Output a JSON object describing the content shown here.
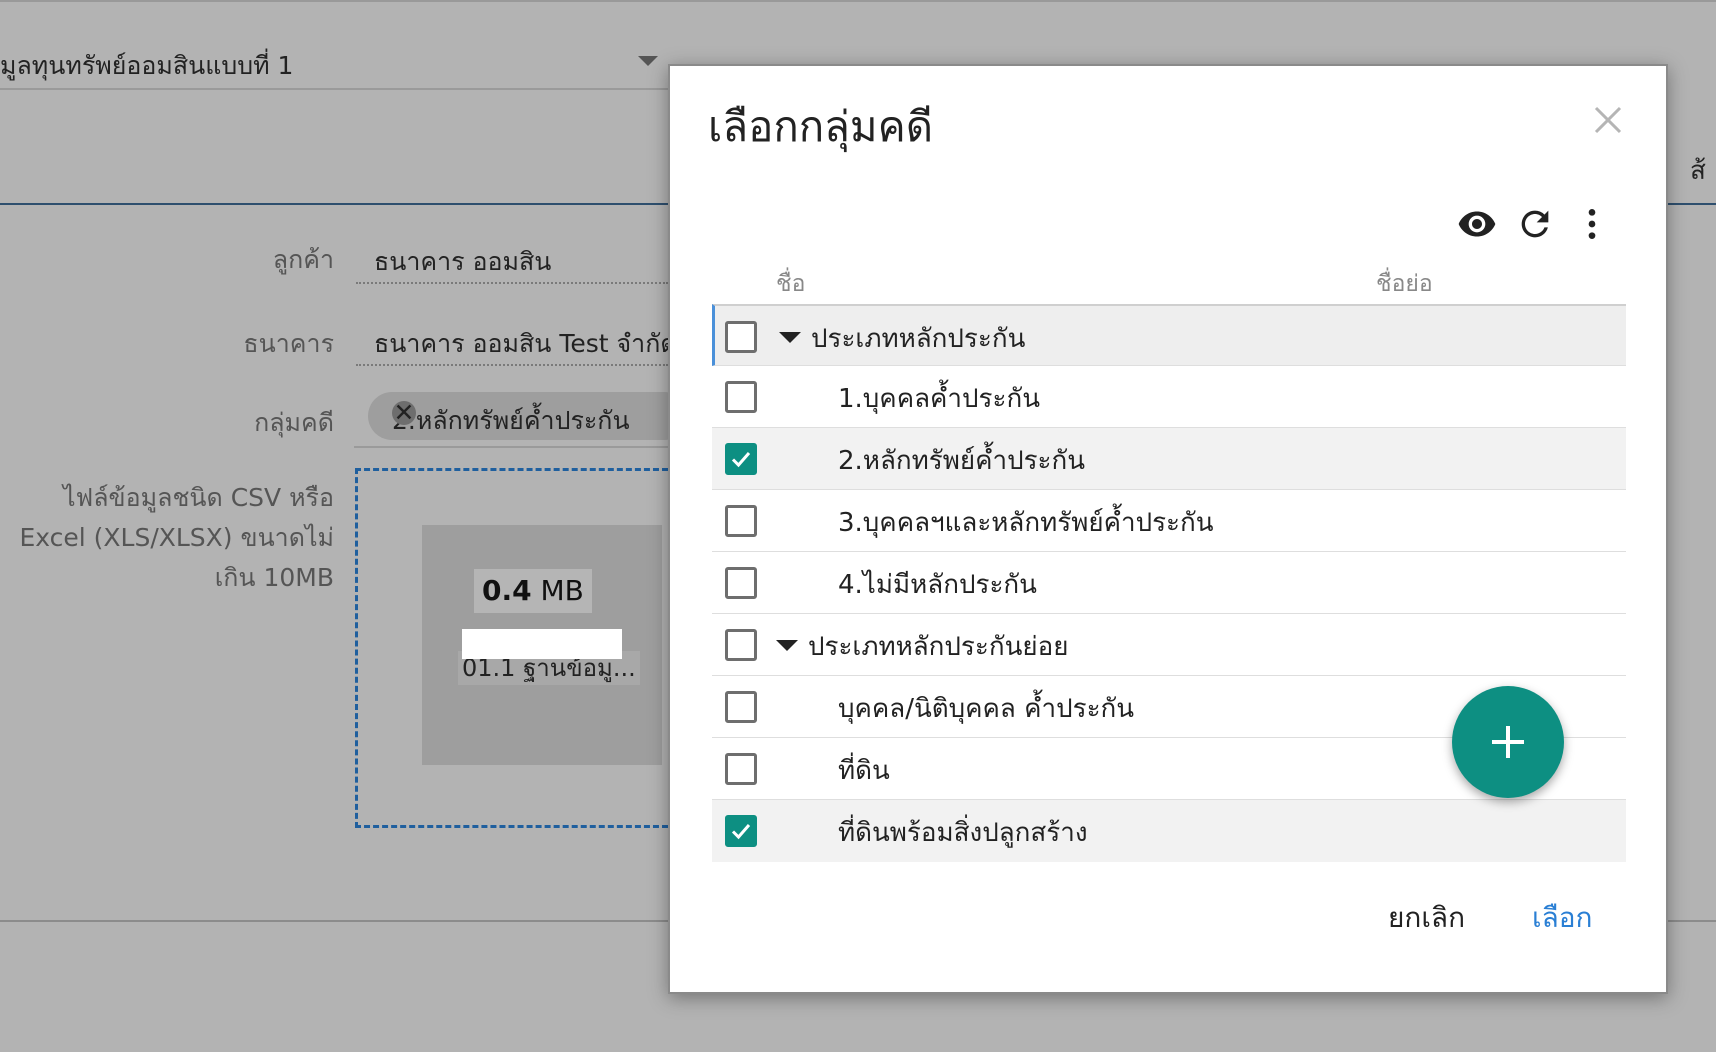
{
  "background": {
    "template_select": "มูลทุนทรัพย์ออมสินแบบที่ 1",
    "right_cut_text": "ส้",
    "fields": {
      "customer_label": "ลูกค้า",
      "customer_value": "ธนาคาร ออมสิน",
      "bank_label": "ธนาคาร",
      "bank_value": "ธนาคาร ออมสิน Test จำกัด",
      "case_group_label": "กลุ่มคดี",
      "case_group_chip": "2.หลักทรัพย์ค้ำประกัน"
    },
    "file": {
      "label": "ไฟล์ข้อมูลชนิด CSV หรือ Excel (XLS/XLSX) ขนาดไม่เกิน 10MB",
      "size_number": "0.4",
      "size_unit": "MB",
      "name": "01.1 ฐานข้อมู..."
    }
  },
  "dialog": {
    "title": "เลือกกลุ่มคดี",
    "columns": {
      "name": "ชื่อ",
      "short_name": "ชื่อย่อ"
    },
    "rows": [
      {
        "label": "ประเภทหลักประกัน",
        "checked": false,
        "group": true
      },
      {
        "label": "1.บุคคลค้ำประกัน",
        "checked": false,
        "group": false
      },
      {
        "label": "2.หลักทรัพย์ค้ำประกัน",
        "checked": true,
        "group": false
      },
      {
        "label": "3.บุคคลฯและหลักทรัพย์ค้ำประกัน",
        "checked": false,
        "group": false
      },
      {
        "label": "4.ไม่มีหลักประกัน",
        "checked": false,
        "group": false
      },
      {
        "label": "ประเภทหลักประกันย่อย",
        "checked": false,
        "group": true
      },
      {
        "label": "บุคคล/นิติบุคคล ค้ำประกัน",
        "checked": false,
        "group": false
      },
      {
        "label": "ที่ดิน",
        "checked": false,
        "group": false
      },
      {
        "label": "ที่ดินพร้อมสิ่งปลูกสร้าง",
        "checked": true,
        "group": false
      }
    ],
    "cancel_label": "ยกเลิก",
    "ok_label": "เลือก"
  },
  "colors": {
    "accent": "#0d8f82",
    "link": "#2a7fd4",
    "overlay": "#b3b3b3"
  }
}
